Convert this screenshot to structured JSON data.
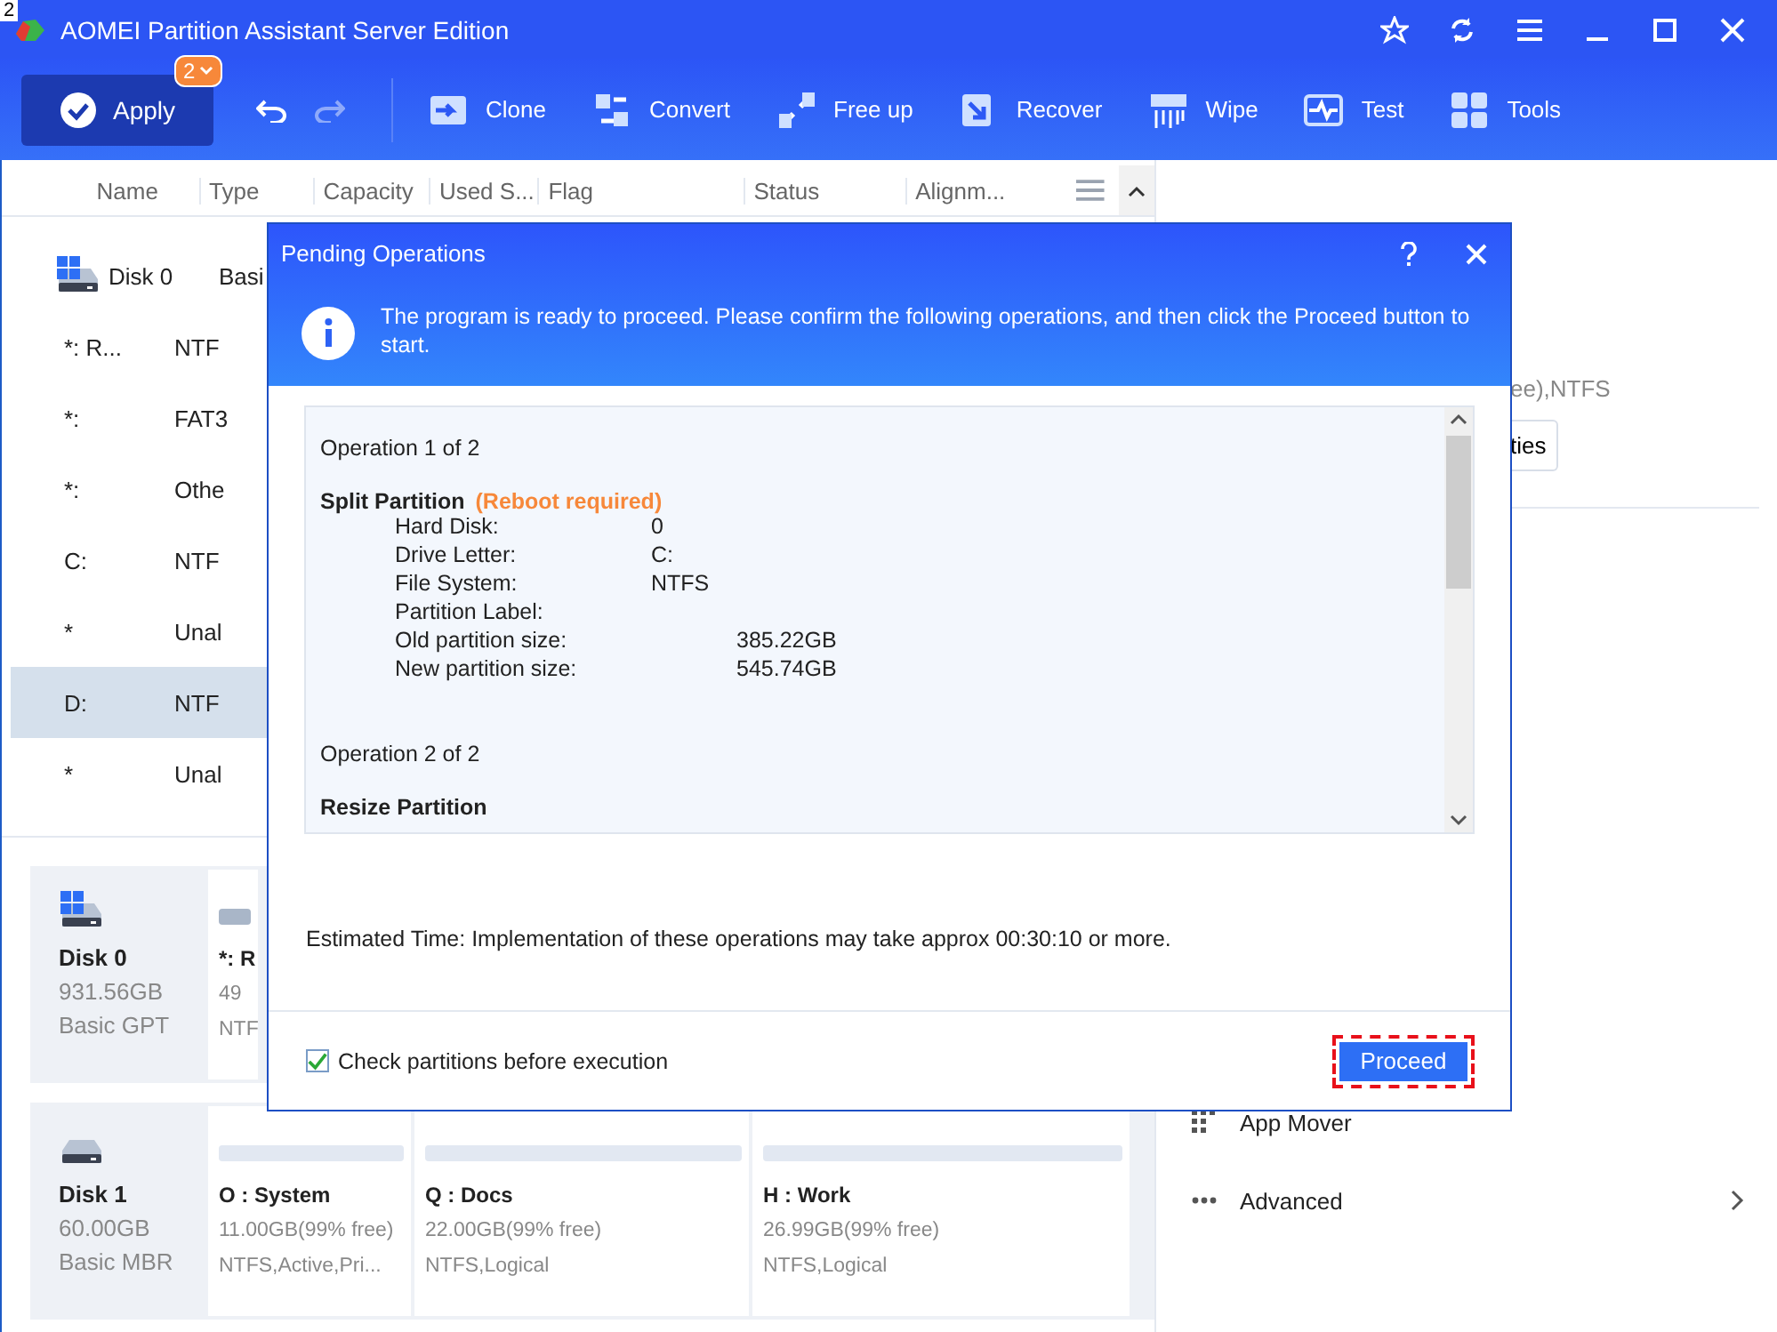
{
  "corner_label": "2",
  "window": {
    "title": "AOMEI Partition Assistant Server Edition"
  },
  "toolbar": {
    "apply": {
      "label": "Apply",
      "badge": "2"
    },
    "history": [
      {
        "kind": "undo",
        "disabled": false
      },
      {
        "kind": "redo",
        "disabled": true
      }
    ],
    "tools": [
      {
        "kind": "clone",
        "label": "Clone"
      },
      {
        "kind": "convert",
        "label": "Convert"
      },
      {
        "kind": "freeup",
        "label": "Free up"
      },
      {
        "kind": "recover",
        "label": "Recover"
      },
      {
        "kind": "wipe",
        "label": "Wipe"
      },
      {
        "kind": "test",
        "label": "Test"
      },
      {
        "kind": "tools",
        "label": "Tools"
      }
    ]
  },
  "table": {
    "columns": [
      "Name",
      "Type",
      "Capacity",
      "Used S...",
      "Flag",
      "Status",
      "Alignm..."
    ],
    "rows": [
      {
        "kind": "disk",
        "name": "Disk 0",
        "type": "Basi",
        "selected": false
      },
      {
        "kind": "partition",
        "name": "*: R...",
        "type": "NTF",
        "selected": false
      },
      {
        "kind": "partition",
        "name": "*:",
        "type": "FAT3",
        "selected": false
      },
      {
        "kind": "partition",
        "name": "*:",
        "type": "Othe",
        "selected": false
      },
      {
        "kind": "partition",
        "name": "C:",
        "type": "NTF",
        "selected": false
      },
      {
        "kind": "partition",
        "name": "*",
        "type": "Unal",
        "selected": false
      },
      {
        "kind": "partition",
        "name": "D:",
        "type": "NTF",
        "selected": true
      },
      {
        "kind": "partition",
        "name": "*",
        "type": "Unal",
        "selected": false
      }
    ]
  },
  "disk_cards": [
    {
      "name": "Disk 0",
      "size": "931.56GB",
      "type": "Basic GPT",
      "system": true,
      "partitions": [
        {
          "name": "*: R",
          "size": "49",
          "detail": "NTF"
        }
      ]
    },
    {
      "name": "Disk 1",
      "size": "60.00GB",
      "type": "Basic MBR",
      "system": false,
      "partitions": [
        {
          "name": "O : System",
          "size": "11.00GB(99% free)",
          "detail": "NTFS,Active,Pri..."
        },
        {
          "name": "Q : Docs",
          "size": "22.00GB(99% free)",
          "detail": "NTFS,Logical"
        },
        {
          "name": "H : Work",
          "size": "26.99GB(99% free)",
          "detail": "NTFS,Logical"
        }
      ]
    }
  ],
  "right_panel": {
    "partition_info": "ee),NTFS",
    "properties_button": "ties",
    "items": [
      {
        "kind": "grid",
        "label": "App Mover",
        "expandable": false
      },
      {
        "kind": "dots",
        "label": "Advanced",
        "expandable": true
      }
    ]
  },
  "dialog": {
    "title": "Pending Operations",
    "message": "The program is ready to proceed. Please confirm the following operations,  and then click the Proceed button to start.",
    "operations": [
      {
        "heading": "Operation 1 of 2",
        "title": "Split Partition",
        "note": "(Reboot required)",
        "details": [
          {
            "kind": "field",
            "label": "Hard Disk:",
            "value": "0"
          },
          {
            "kind": "field",
            "label": "Drive Letter:",
            "value": "C:"
          },
          {
            "kind": "field",
            "label": "File System:",
            "value": "NTFS"
          },
          {
            "kind": "field",
            "label": "Partition Label:"
          },
          {
            "kind": "size",
            "label": "Old partition size:",
            "value": "385.22GB"
          },
          {
            "kind": "size",
            "label": "New partition size:",
            "value": "545.74GB"
          }
        ]
      },
      {
        "heading": "Operation 2 of 2",
        "title": "Resize Partition"
      }
    ],
    "estimate": "Estimated Time: Implementation of these operations may take approx 00:30:10 or more.",
    "check": {
      "label": "Check partitions before execution",
      "checked": true
    },
    "proceed": {
      "label": "Proceed",
      "focused": true
    }
  }
}
